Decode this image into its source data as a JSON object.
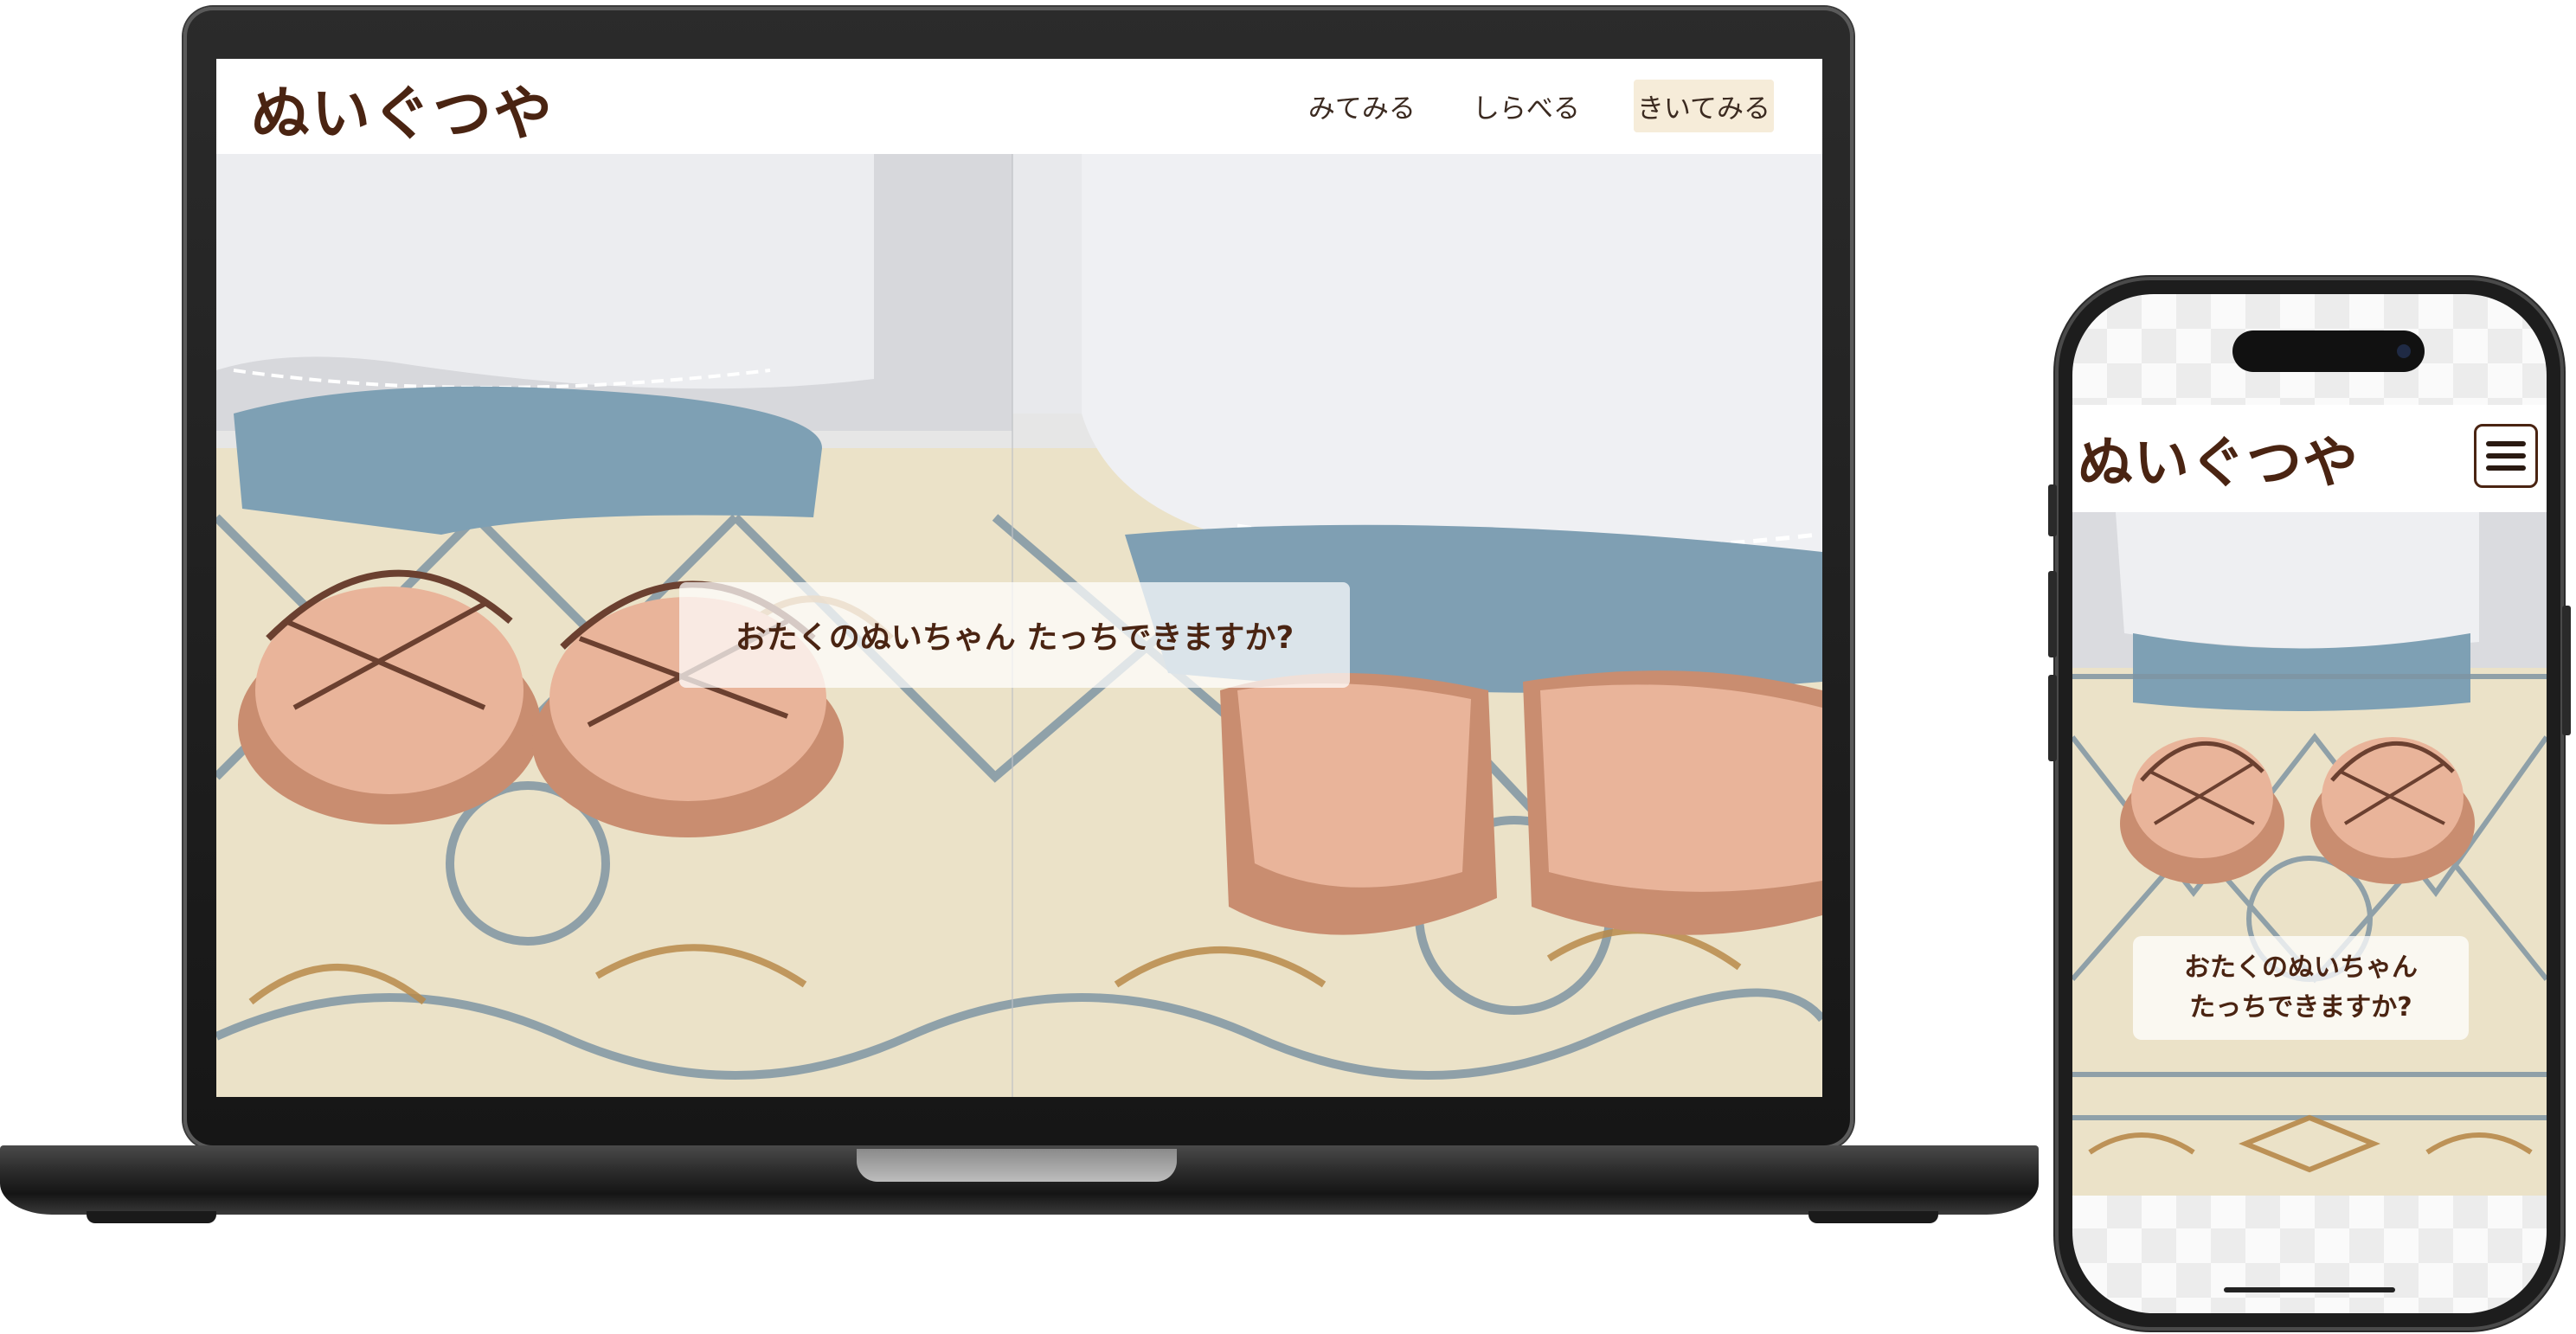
{
  "site": {
    "brand": "ぬいぐつや",
    "nav": [
      {
        "label": "みてみる",
        "active": false
      },
      {
        "label": "しらべる",
        "active": false
      },
      {
        "label": "きいてみる",
        "active": true
      }
    ],
    "hero_caption": "おたくのぬいちゃん たっちできますか?"
  },
  "mobile": {
    "brand": "ぬいぐつや",
    "menu_icon": "hamburger-menu-icon",
    "hero_caption_line1": "おたくのぬいちゃん",
    "hero_caption_line2": "たっちできますか?"
  },
  "colors": {
    "brand": "#4a2412",
    "nav_active_bg": "#f6ecd9",
    "device_frame": "#1d1d1d"
  }
}
